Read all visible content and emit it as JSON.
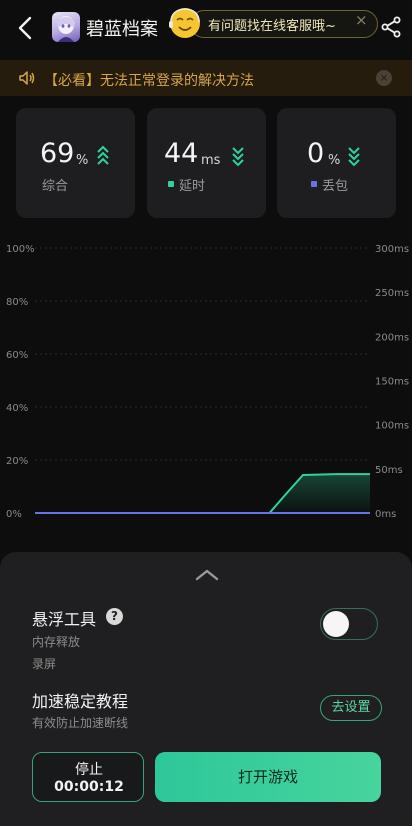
{
  "header": {
    "game_title": "碧蓝档案",
    "service_text": "有问题找在线客服哦~",
    "service_close": "×"
  },
  "notice": {
    "text": "【必看】无法正常登录的解决方法",
    "close": "×"
  },
  "stats": {
    "overall": {
      "value": "69",
      "unit": "%",
      "label": "综合",
      "trend": "up"
    },
    "latency": {
      "value": "44",
      "unit": "ms",
      "label": "延时",
      "trend": "down",
      "color": "#2fd39a"
    },
    "loss": {
      "value": "0",
      "unit": "%",
      "label": "丢包",
      "trend": "down",
      "color": "#6a72e8"
    }
  },
  "chart_data": {
    "type": "line",
    "left_axis": {
      "ticks": [
        "100%",
        "80%",
        "60%",
        "40%",
        "20%",
        "0%"
      ],
      "ylim": [
        0,
        100
      ]
    },
    "right_axis": {
      "ticks": [
        "300ms",
        "250ms",
        "200ms",
        "150ms",
        "100ms",
        "50ms",
        "0ms"
      ],
      "ylim": [
        0,
        300
      ]
    },
    "x": [
      0,
      10,
      20,
      30,
      40,
      50,
      60,
      65,
      70,
      75,
      80,
      90,
      100
    ],
    "series": [
      {
        "values": [
          0,
          0,
          0,
          0,
          0,
          0,
          0,
          0,
          0,
          22,
          43,
          44,
          44
        ],
        "axis": "right",
        "color": "#2fd39a"
      },
      {
        "values": [
          0,
          0,
          0,
          0,
          0,
          0,
          0,
          0,
          0,
          0,
          0,
          0,
          0
        ],
        "axis": "left",
        "color": "#6a72e8"
      }
    ]
  },
  "sheet": {
    "float_tool": {
      "title": "悬浮工具",
      "help": "?",
      "sub1": "内存释放",
      "sub2": "录屏",
      "toggle_on": false
    },
    "tutorial": {
      "title": "加速稳定教程",
      "sub": "有效防止加速断线",
      "button": "去设置"
    }
  },
  "footer": {
    "stop_label": "停止",
    "stop_time": "00:00:12",
    "open_label": "打开游戏"
  }
}
